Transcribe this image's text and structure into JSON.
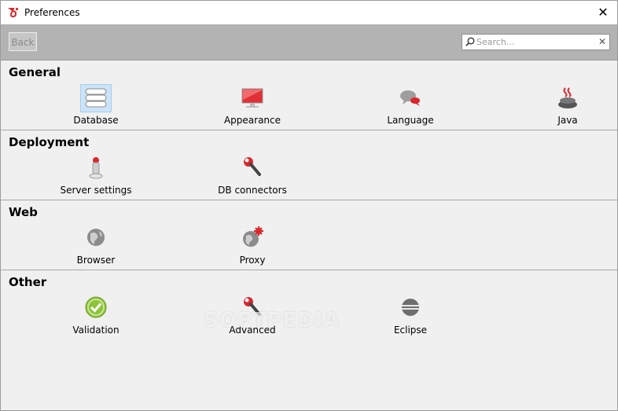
{
  "window": {
    "title": "Preferences",
    "close_label": "✕"
  },
  "toolbar": {
    "back_label": "Back",
    "search_placeholder": "Search...",
    "clear_label": "✕"
  },
  "sections": [
    {
      "title": "General",
      "items": [
        {
          "label": "Database",
          "icon": "database-icon",
          "selected": true
        },
        {
          "label": "Appearance",
          "icon": "monitor-icon"
        },
        {
          "label": "Language",
          "icon": "speech-bubbles-icon"
        },
        {
          "label": "Java",
          "icon": "java-cup-icon"
        }
      ]
    },
    {
      "title": "Deployment",
      "items": [
        {
          "label": "Server settings",
          "icon": "server-icon"
        },
        {
          "label": "DB connectors",
          "icon": "wrench-icon"
        }
      ]
    },
    {
      "title": "Web",
      "items": [
        {
          "label": "Browser",
          "icon": "globe-icon"
        },
        {
          "label": "Proxy",
          "icon": "globe-gear-icon"
        }
      ]
    },
    {
      "title": "Other",
      "items": [
        {
          "label": "Validation",
          "icon": "checkmark-icon"
        },
        {
          "label": "Advanced",
          "icon": "wrench-icon"
        },
        {
          "label": "Eclipse",
          "icon": "eclipse-icon"
        }
      ]
    }
  ],
  "watermark": "SOFTPEDIA",
  "colors": {
    "accent_red": "#d9272e",
    "toolbar_gray": "#b3b3b3",
    "section_bg": "#f0f0f0"
  }
}
